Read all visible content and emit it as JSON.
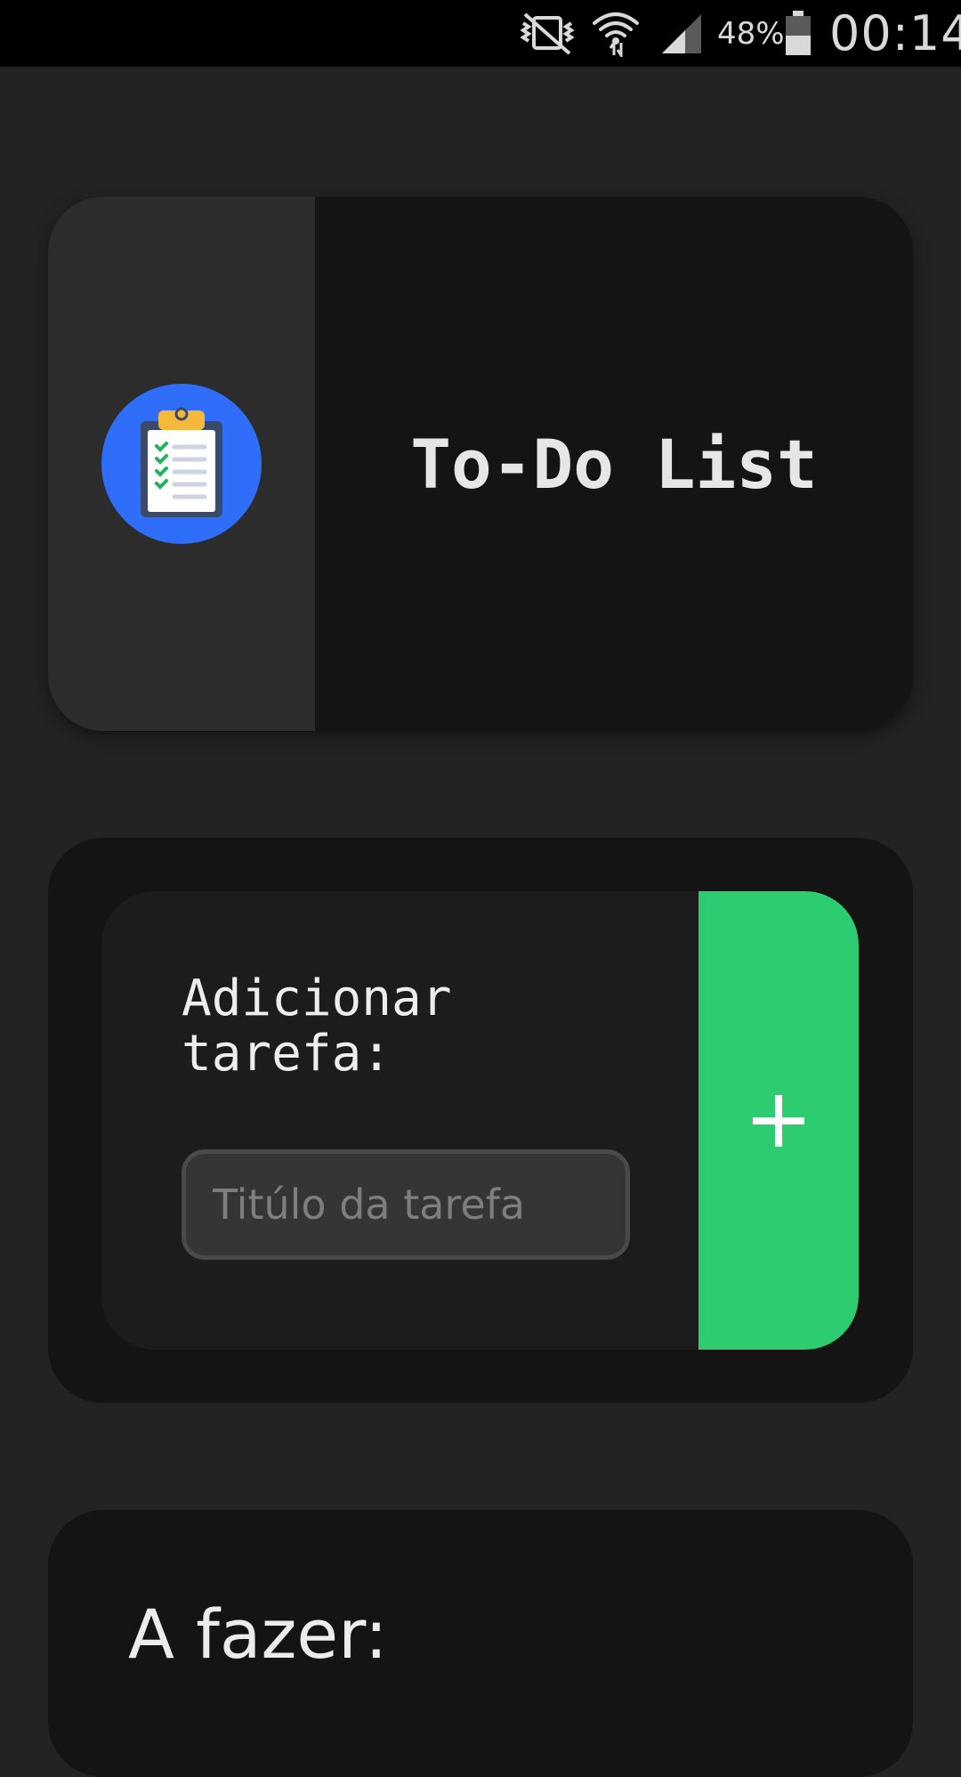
{
  "status_bar": {
    "battery_percent": "48%",
    "time": "00:14",
    "icons": [
      "vibrate-off-icon",
      "wifi-icon",
      "signal-icon",
      "battery-icon"
    ]
  },
  "header": {
    "logo_icon": "clipboard-checklist-icon",
    "title": "To-Do List"
  },
  "add_task": {
    "label": "Adicionar tarefa:",
    "input_placeholder": "Titúlo da tarefa",
    "input_value": "",
    "button_icon": "plus-icon"
  },
  "todo": {
    "heading": "A fazer:"
  },
  "colors": {
    "background": "#232323",
    "card": "#141414",
    "accent_green": "#2ecc71",
    "logo_blue": "#2f6ef8"
  }
}
